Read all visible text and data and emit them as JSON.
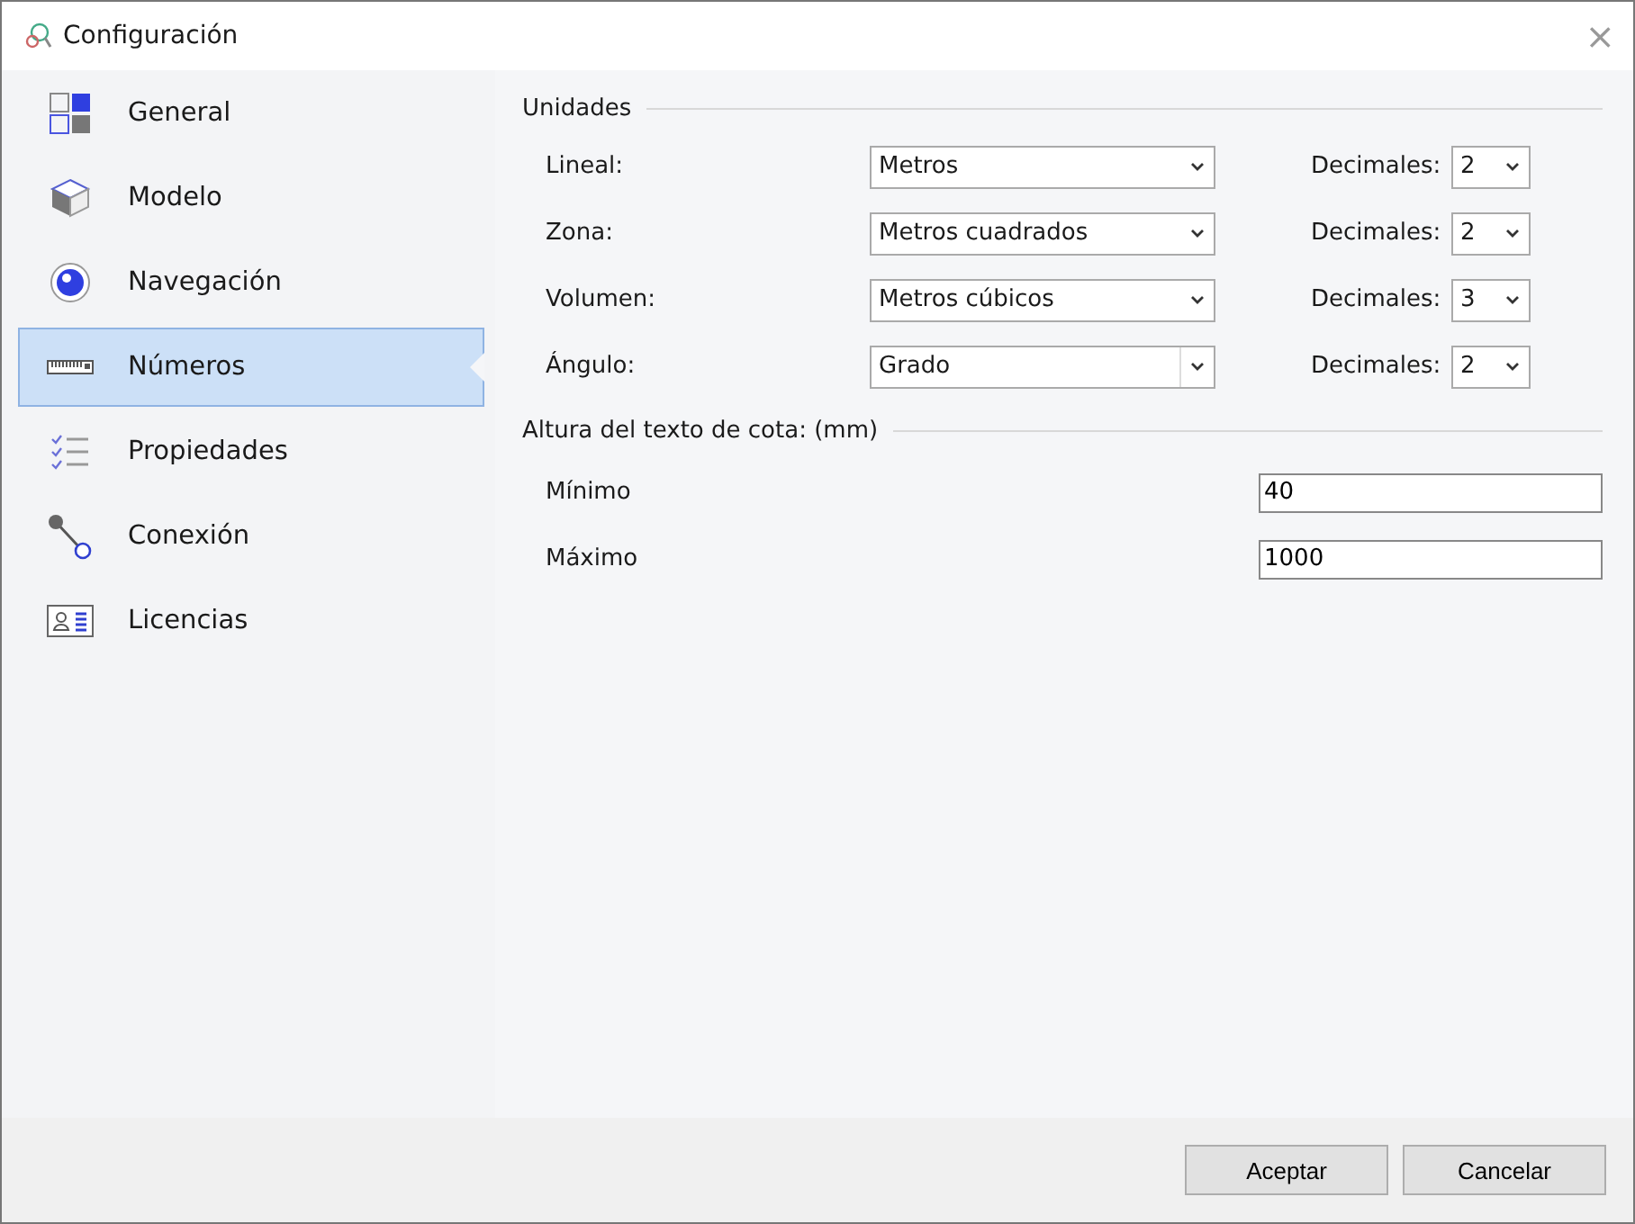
{
  "window": {
    "title": "Configuración",
    "close": "×"
  },
  "sidebar": {
    "items": [
      {
        "label": "General",
        "selected": false
      },
      {
        "label": "Modelo",
        "selected": false
      },
      {
        "label": "Navegación",
        "selected": false
      },
      {
        "label": "Números",
        "selected": true
      },
      {
        "label": "Propiedades",
        "selected": false
      },
      {
        "label": "Conexión",
        "selected": false
      },
      {
        "label": "Licencias",
        "selected": false
      }
    ]
  },
  "units": {
    "title": "Unidades",
    "rows": [
      {
        "label": "Lineal:",
        "value": "Metros",
        "kind": "dropdown",
        "decimals_label": "Decimales:",
        "decimals": "2"
      },
      {
        "label": "Zona:",
        "value": "Metros cuadrados",
        "kind": "dropdown",
        "decimals_label": "Decimales:",
        "decimals": "2"
      },
      {
        "label": "Volumen:",
        "value": "Metros cúbicos",
        "kind": "dropdown",
        "decimals_label": "Decimales:",
        "decimals": "3"
      },
      {
        "label": "Ángulo:",
        "value": "Grado",
        "kind": "combo",
        "decimals_label": "Decimales:",
        "decimals": "2"
      }
    ]
  },
  "text_height": {
    "title": "Altura del texto de cota: (mm)",
    "fields": [
      {
        "label": "Mínimo",
        "value": "40"
      },
      {
        "label": "Máximo",
        "value": "1000"
      }
    ]
  },
  "buttons": [
    "Aceptar",
    "Cancelar"
  ]
}
